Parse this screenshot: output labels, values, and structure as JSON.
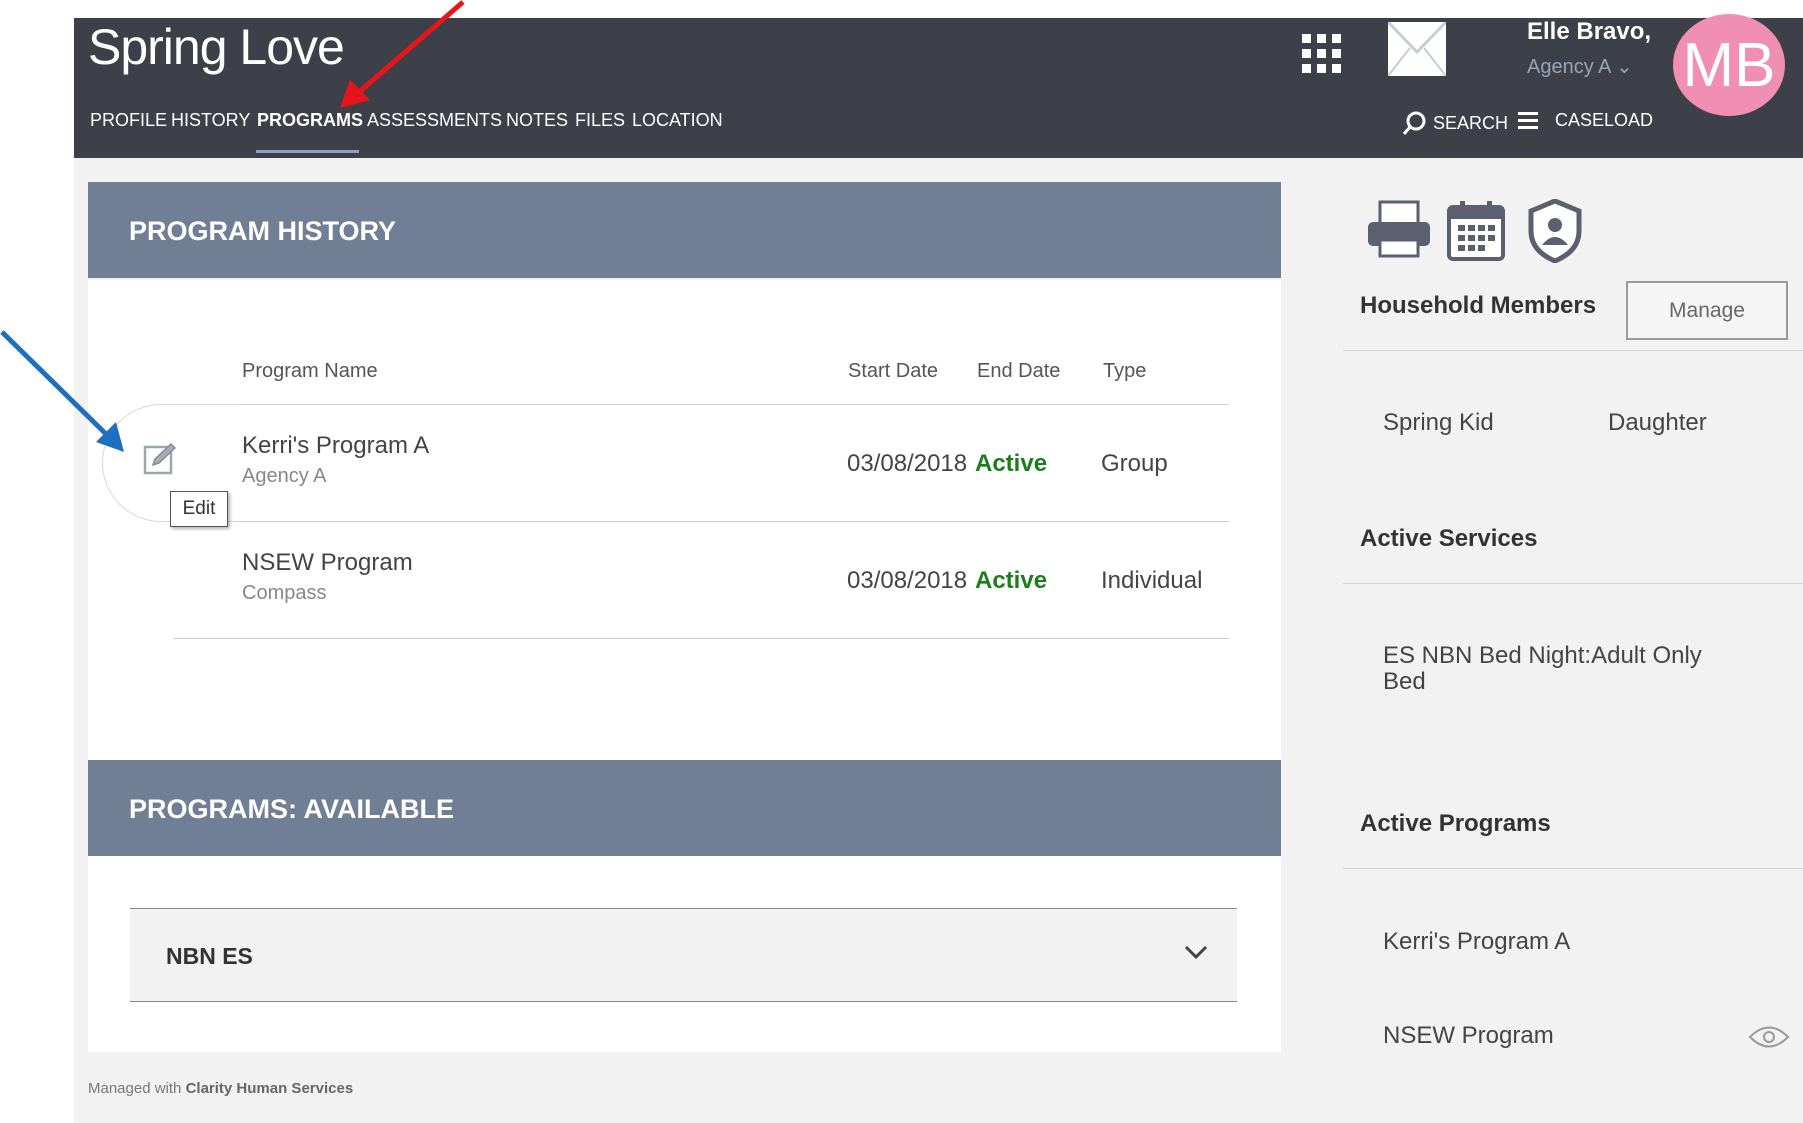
{
  "header": {
    "title": "Spring Love",
    "nav": [
      "PROFILE",
      "HISTORY",
      "PROGRAMS",
      "ASSESSMENTS",
      "NOTES",
      "FILES",
      "LOCATION"
    ],
    "active_nav": "PROGRAMS",
    "user_name": "Elle Bravo,",
    "agency": "Agency A",
    "avatar_initials": "MB",
    "search_label": "SEARCH",
    "caseload_label": "CASELOAD"
  },
  "program_history": {
    "title": "PROGRAM HISTORY",
    "columns": [
      "Program Name",
      "Start Date",
      "End Date",
      "Type"
    ],
    "rows": [
      {
        "name": "Kerri's Program A",
        "agency": "Agency A",
        "start": "03/08/2018",
        "end": "Active",
        "type": "Group"
      },
      {
        "name": "NSEW Program",
        "agency": "Compass",
        "start": "03/08/2018",
        "end": "Active",
        "type": "Individual"
      }
    ],
    "edit_tooltip": "Edit"
  },
  "programs_available": {
    "title": "PROGRAMS: AVAILABLE",
    "items": [
      "NBN ES"
    ]
  },
  "sidebar": {
    "household_title": "Household Members",
    "manage_label": "Manage",
    "household": [
      {
        "name": "Spring Kid",
        "relation": "Daughter"
      }
    ],
    "active_services_title": "Active Services",
    "services": [
      "ES NBN Bed Night:Adult Only Bed"
    ],
    "active_programs_title": "Active Programs",
    "programs": [
      "Kerri's Program A",
      "NSEW Program"
    ]
  },
  "footer": {
    "prefix": "Managed with",
    "brand": "Clarity Human Services"
  },
  "colors": {
    "header": "#3e4049",
    "panel_head": "#707e96",
    "active": "#1a7f1a",
    "avatar": "#f08fb1",
    "red_arrow": "#e8141b",
    "blue_arrow": "#1f6fc0"
  }
}
